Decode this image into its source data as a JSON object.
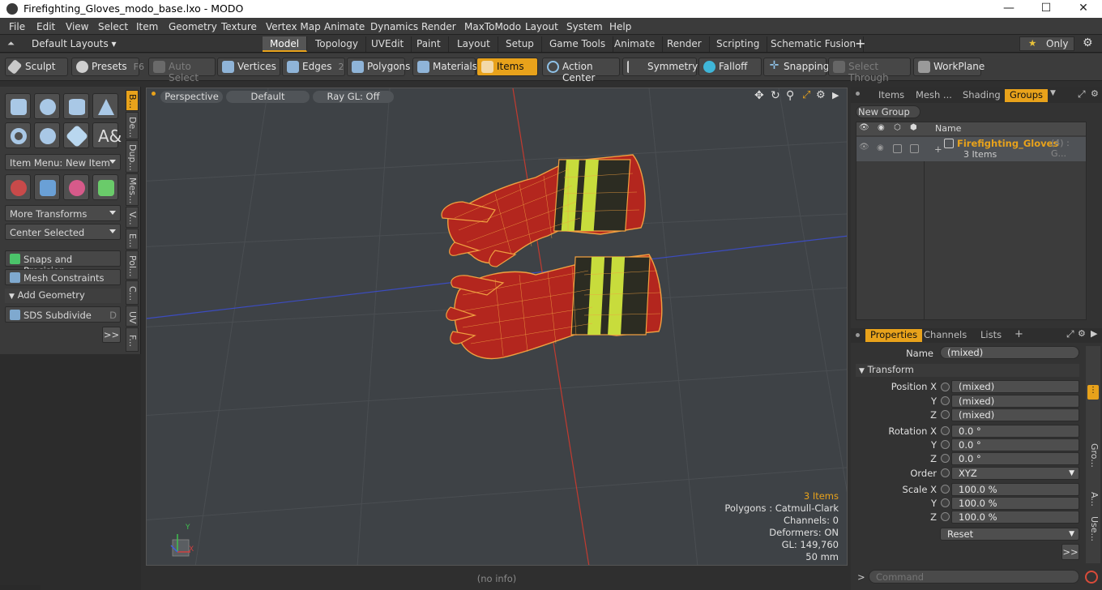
{
  "window": {
    "title": "Firefighting_Gloves_modo_base.lxo - MODO",
    "minimize": "—",
    "maximize": "☐",
    "close": "✕"
  },
  "menu": [
    "File",
    "Edit",
    "View",
    "Select",
    "Item",
    "Geometry",
    "Texture",
    "Vertex Map",
    "Animate",
    "Dynamics",
    "Render",
    "MaxToModo",
    "Layout",
    "System",
    "Help"
  ],
  "layout_selector": "Default Layouts ▾",
  "layout_tabs": [
    "Model",
    "Topology",
    "UVEdit",
    "Paint",
    "Layout",
    "Setup",
    "Game Tools",
    "Animate",
    "Render",
    "Scripting",
    "Schematic Fusion"
  ],
  "layout_tab_add": "+",
  "only_label": "Only",
  "star": "★",
  "toolbar": {
    "sculpt": "Sculpt",
    "presets": "Presets",
    "presets_key": "F6",
    "auto_select": "Auto Select",
    "vertices": "Vertices",
    "vertices_key": "1",
    "edges": "Edges",
    "edges_key": "2",
    "polygons": "Polygons",
    "materials": "Materials",
    "items": "Items",
    "action_center": "Action Center",
    "symmetry": "Symmetry",
    "falloff": "Falloff",
    "snapping": "Snapping",
    "select_through": "Select Through",
    "workplane": "WorkPlane"
  },
  "left": {
    "item_menu": "Item Menu: New Item",
    "more_transforms": "More Transforms",
    "center_selected": "Center Selected",
    "snaps": "Snaps and Precision",
    "mesh_constraints": "Mesh Constraints",
    "add_geometry": "Add Geometry",
    "sds_subdivide": "SDS Subdivide",
    "sds_key": "D",
    "more": ">>",
    "vtabs": [
      "B...",
      "De...",
      "Dup...",
      "Mes...",
      "V...",
      "E...",
      "Pol...",
      "C...",
      "UV",
      "F..."
    ]
  },
  "viewport": {
    "view": "Perspective",
    "shading": "Default",
    "raygl": "Ray GL: Off",
    "stats": {
      "items": "3 Items",
      "polygons": "Polygons : Catmull-Clark",
      "channels": "Channels: 0",
      "deformers": "Deformers: ON",
      "gl": "GL: 149,760",
      "scale": "50 mm"
    },
    "axis_x": "X",
    "axis_y": "Y"
  },
  "status": "(no info)",
  "right": {
    "tabs": [
      "Items",
      "Mesh ...",
      "Shading",
      "Groups"
    ],
    "new_group": "New Group",
    "name_col": "Name",
    "group_name": "Firefighting_Gloves",
    "group_count": "(4) : G...",
    "group_items": "3 Items",
    "props_tabs": [
      "Properties",
      "Channels",
      "Lists"
    ],
    "props_add": "+",
    "name_label": "Name",
    "name_value": "(mixed)",
    "transform": "Transform",
    "position_x_label": "Position X",
    "y_label": "Y",
    "z_label": "Z",
    "pos_x": "(mixed)",
    "pos_y": "(mixed)",
    "pos_z": "(mixed)",
    "rotation_x_label": "Rotation X",
    "rot_x": "0.0 °",
    "rot_y": "0.0 °",
    "rot_z": "0.0 °",
    "order_label": "Order",
    "order": "XYZ",
    "scale_x_label": "Scale X",
    "scale_x": "100.0 %",
    "scale_y": "100.0 %",
    "scale_z": "100.0 %",
    "reset": "Reset",
    "more": ">>",
    "side_tabs": [
      "Gro...",
      "A...",
      "Use..."
    ],
    "command_prompt": ">",
    "command_placeholder": "Command"
  },
  "colors": {
    "accent": "#e8a21b",
    "glove_red": "#b3261e",
    "wire_orange": "#f0a040",
    "band_yellow": "#c8dc3c"
  }
}
